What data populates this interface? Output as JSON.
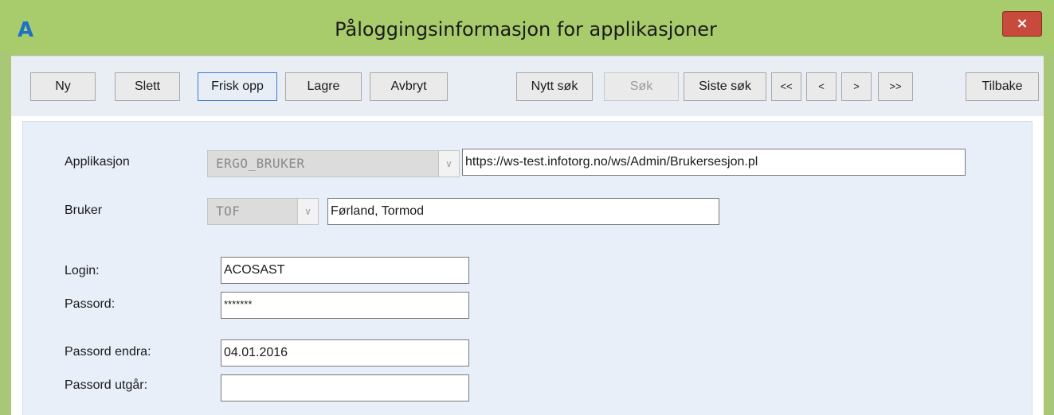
{
  "window": {
    "title": "Påloggingsinformasjon for applikasjoner",
    "app_icon": "A",
    "close_symbol": "×"
  },
  "toolbar": {
    "new_label": "Ny",
    "delete_label": "Slett",
    "refresh_label": "Frisk opp",
    "save_label": "Lagre",
    "cancel_label": "Avbryt",
    "new_search_label": "Nytt søk",
    "search_label": "Søk",
    "last_search_label": "Siste søk",
    "first_label": "<<",
    "prev_label": "<",
    "next_label": ">",
    "last_label": ">>",
    "back_label": "Tilbake"
  },
  "form": {
    "application": {
      "label": "Applikasjon",
      "code": "ERGO_BRUKER",
      "url": "https://ws-test.infotorg.no/ws/Admin/Brukersesjon.pl"
    },
    "user": {
      "label": "Bruker",
      "code": "TOF",
      "name": "Førland, Tormod"
    },
    "login": {
      "label": "Login:",
      "value": "ACOSAST"
    },
    "password": {
      "label": "Passord:",
      "value": "*******"
    },
    "password_changed": {
      "label": "Passord endra:",
      "value": "04.01.2016"
    },
    "password_expires": {
      "label": "Passord utgår:",
      "value": ""
    }
  },
  "colors": {
    "titlebar": "#a8cc6c",
    "panel": "#e9eff8",
    "close_button": "#c84a3c",
    "focus_border": "#3b7ad0"
  },
  "icons": {
    "app": "app-logo-icon",
    "close": "close-icon",
    "dropdown": "chevron-down-icon"
  }
}
